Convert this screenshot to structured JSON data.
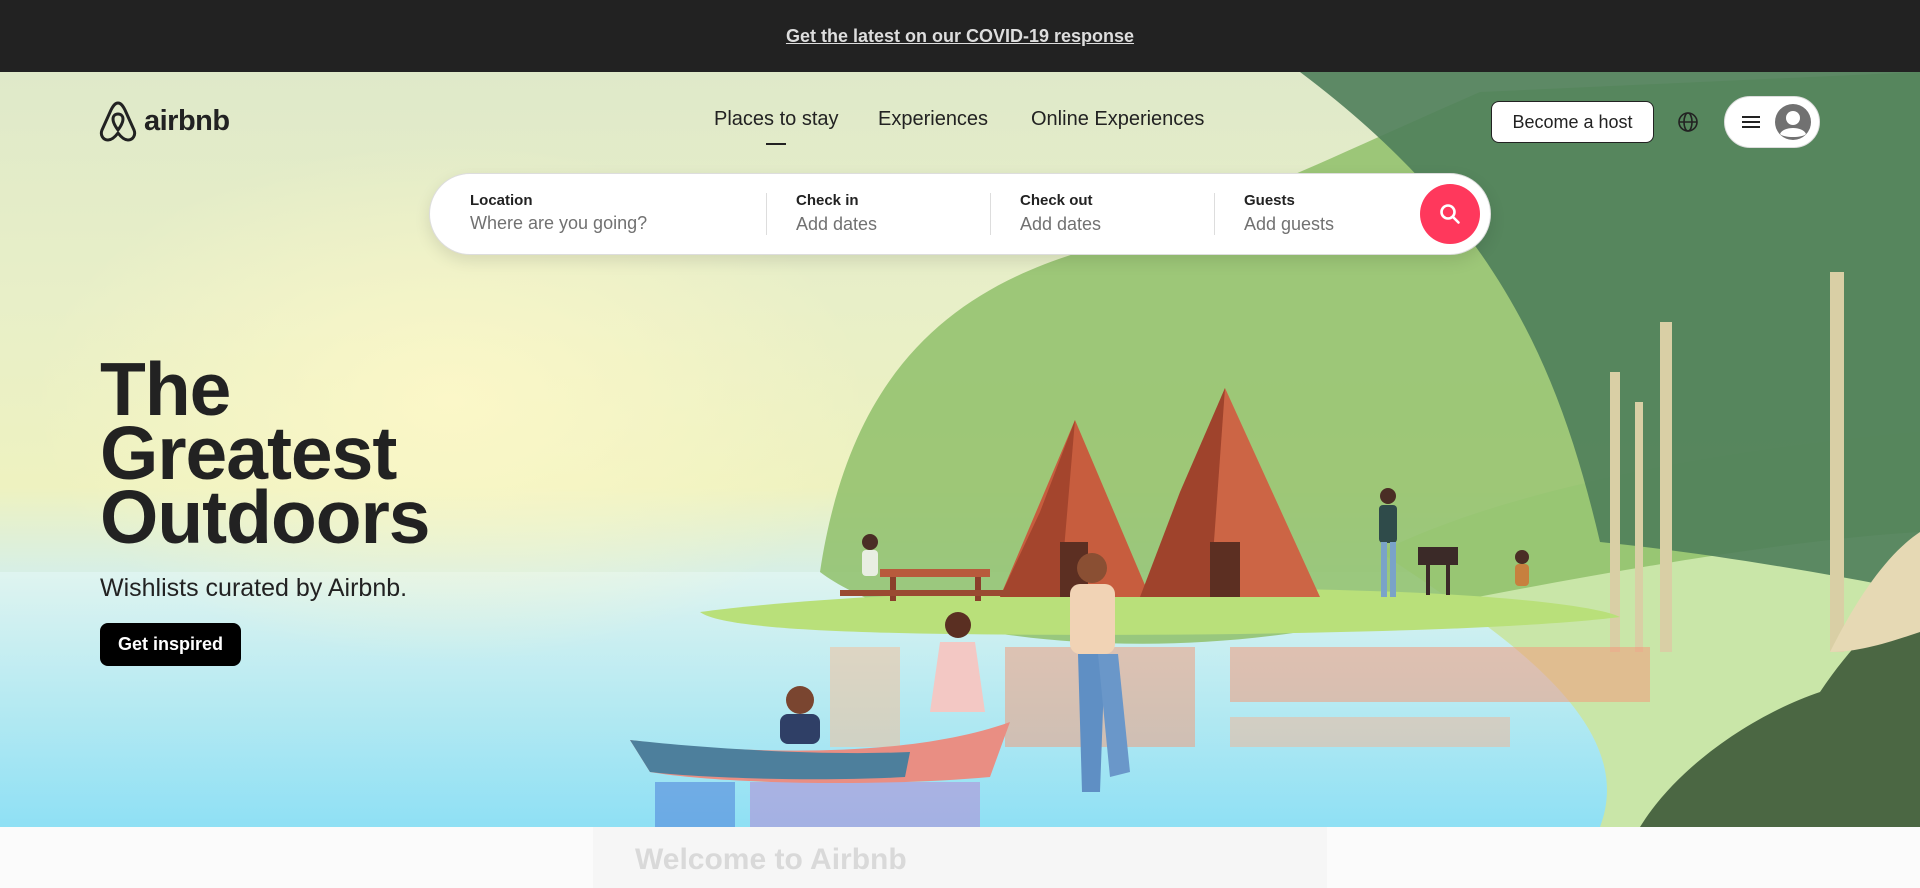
{
  "banner": {
    "link_text": "Get the latest on our COVID-19 response"
  },
  "header": {
    "logo_text": "airbnb",
    "nav": [
      {
        "label": "Places to stay",
        "active": true
      },
      {
        "label": "Experiences",
        "active": false
      },
      {
        "label": "Online Experiences",
        "active": false
      }
    ],
    "host_button": "Become a host",
    "globe_icon": "globe-icon",
    "menu_icon": "hamburger-menu-icon",
    "avatar_icon": "user-avatar-icon"
  },
  "search": {
    "location": {
      "label": "Location",
      "placeholder": "Where are you going?"
    },
    "check_in": {
      "label": "Check in",
      "value": "Add dates"
    },
    "check_out": {
      "label": "Check out",
      "value": "Add dates"
    },
    "guests": {
      "label": "Guests",
      "value": "Add guests"
    },
    "button_icon": "search-icon"
  },
  "hero": {
    "title_lines": [
      "The",
      "Greatest",
      "Outdoors"
    ],
    "subtitle": "Wishlists curated by Airbnb.",
    "cta": "Get inspired"
  },
  "below": {
    "welcome": "Welcome to Airbnb"
  },
  "colors": {
    "brand": "#ff385c",
    "text": "#222222",
    "banner_bg": "#222222"
  }
}
